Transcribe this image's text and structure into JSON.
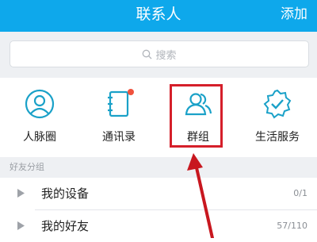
{
  "header": {
    "title": "联系人",
    "add_label": "添加"
  },
  "search": {
    "placeholder": "搜索"
  },
  "entries": [
    {
      "label": "人脉圈",
      "icon": "person-circle-icon"
    },
    {
      "label": "通讯录",
      "icon": "address-book-icon",
      "badge": true
    },
    {
      "label": "群组",
      "icon": "group-icon",
      "highlighted": true
    },
    {
      "label": "生活服务",
      "icon": "service-shield-icon"
    }
  ],
  "friends": {
    "section_title": "好友分组",
    "groups": [
      {
        "name": "我的设备",
        "count": "0/1"
      },
      {
        "name": "我的好友",
        "count": "57/110"
      }
    ]
  },
  "colors": {
    "header_bg": "#0ea8eb",
    "icon_accent": "#1aa1c8",
    "highlight": "#d51f2a",
    "badge": "#f0523d"
  }
}
